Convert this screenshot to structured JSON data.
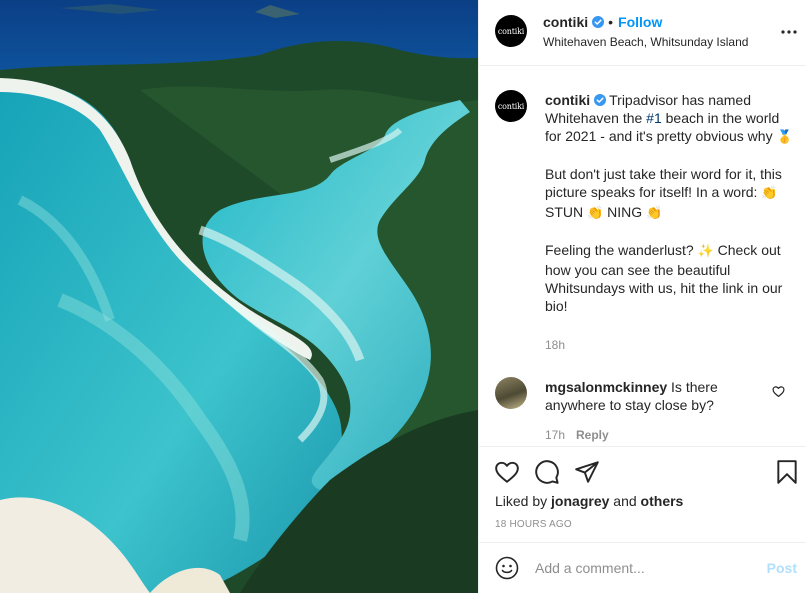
{
  "post": {
    "username": "contiki",
    "avatar_text": "contiki",
    "separator": "•",
    "follow_label": "Follow",
    "location": "Whitehaven Beach, Whitsunday Island",
    "more_icon": "more-options-icon"
  },
  "caption": {
    "username": "contiki",
    "text_1a": "Tripadvisor has named Whitehaven the ",
    "hashtag": "#1",
    "text_1b": " beach in the world for 2021 - and it's pretty obvious why ",
    "emoji_medal": "🥇",
    "text_2a": "But don't just take their word for it, this picture speaks for itself! In a word: ",
    "emoji_clap": "👏",
    "word_stun": " STUN ",
    "word_ning": " NING ",
    "text_3a": "Feeling the wanderlust? ",
    "emoji_sparkle": "✨",
    "text_3b": " Check out how you can see the beautiful Whitsundays with us, hit the link in our bio!",
    "time": "18h"
  },
  "comment": {
    "username": "mgsalonmckinney",
    "text": "Is there anywhere to stay close by?",
    "time": "17h",
    "reply_label": "Reply"
  },
  "actions": {
    "liked_prefix": "Liked by ",
    "liked_user": "jonagrey",
    "liked_and": " and ",
    "liked_others": "others",
    "posted_time": "18 HOURS AGO"
  },
  "add_comment": {
    "placeholder": "Add a comment...",
    "post_label": "Post"
  },
  "colors": {
    "accent": "#0095f6",
    "post_disabled": "#b2dffc",
    "verified": "#3897f0"
  }
}
